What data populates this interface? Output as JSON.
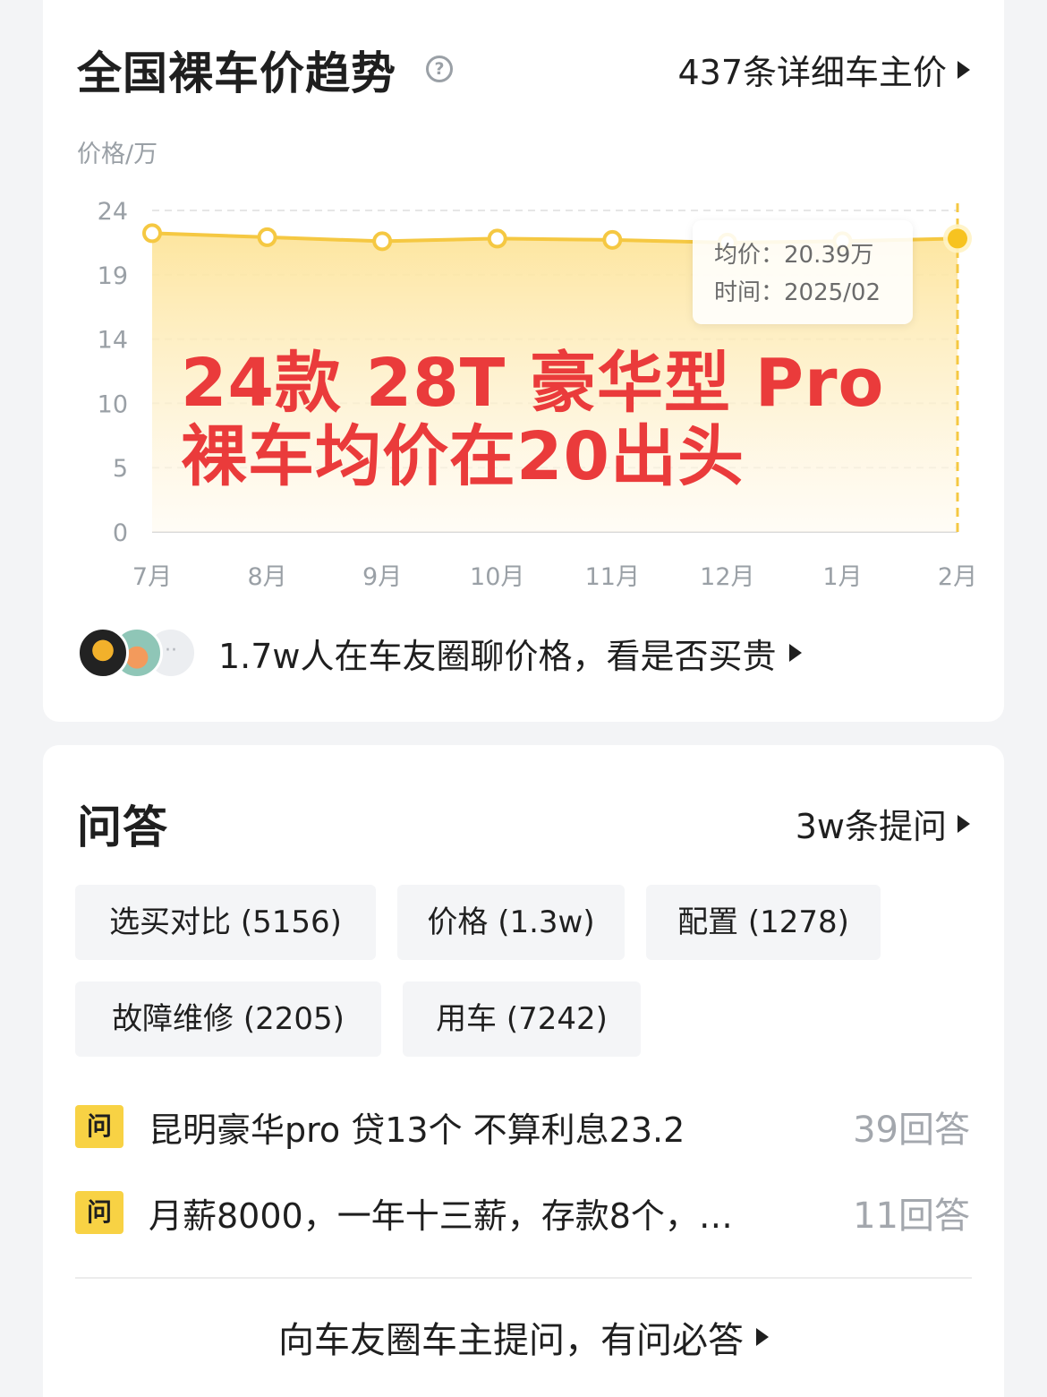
{
  "price_trend": {
    "title": "全国裸车价趋势",
    "help_icon": "question-circle-icon",
    "detail_link": "437条详细车主价",
    "y_unit": "价格/万",
    "tooltip": {
      "line1": "均价：20.39万",
      "line2": "时间：2025/02"
    },
    "overlay": {
      "line1": "24款 28T 豪华型 Pro",
      "line2": "裸车均价在20出头"
    },
    "social_text": "1.7w人在车友圈聊价格，看是否买贵"
  },
  "chart_data": {
    "type": "area",
    "x": [
      "7月",
      "8月",
      "9月",
      "10月",
      "11月",
      "12月",
      "1月",
      "2月"
    ],
    "y_ticks": [
      "24",
      "19",
      "14",
      "10",
      "5",
      "0"
    ],
    "values": [
      22.3,
      22.0,
      21.7,
      21.9,
      21.8,
      21.6,
      21.7,
      21.9
    ],
    "selected_index": 7,
    "ylim": [
      0,
      24
    ],
    "grid": true,
    "line_color": "#f5c842",
    "fill_color": "#fde9a6"
  },
  "qa": {
    "title": "问答",
    "more_link": "3w条提问",
    "tags": [
      "选买对比 (5156)",
      "价格 (1.3w)",
      "配置 (1278)",
      "故障维修 (2205)",
      "用车 (7242)"
    ],
    "questions": [
      {
        "badge": "问",
        "text": "昆明豪华pro 贷13个 不算利息23.2",
        "count": "39回答"
      },
      {
        "badge": "问",
        "text": "月薪8000，一年十三薪，存款8个，…",
        "count": "11回答"
      }
    ],
    "ask_link": "向车友圈车主提问，有问必答"
  }
}
